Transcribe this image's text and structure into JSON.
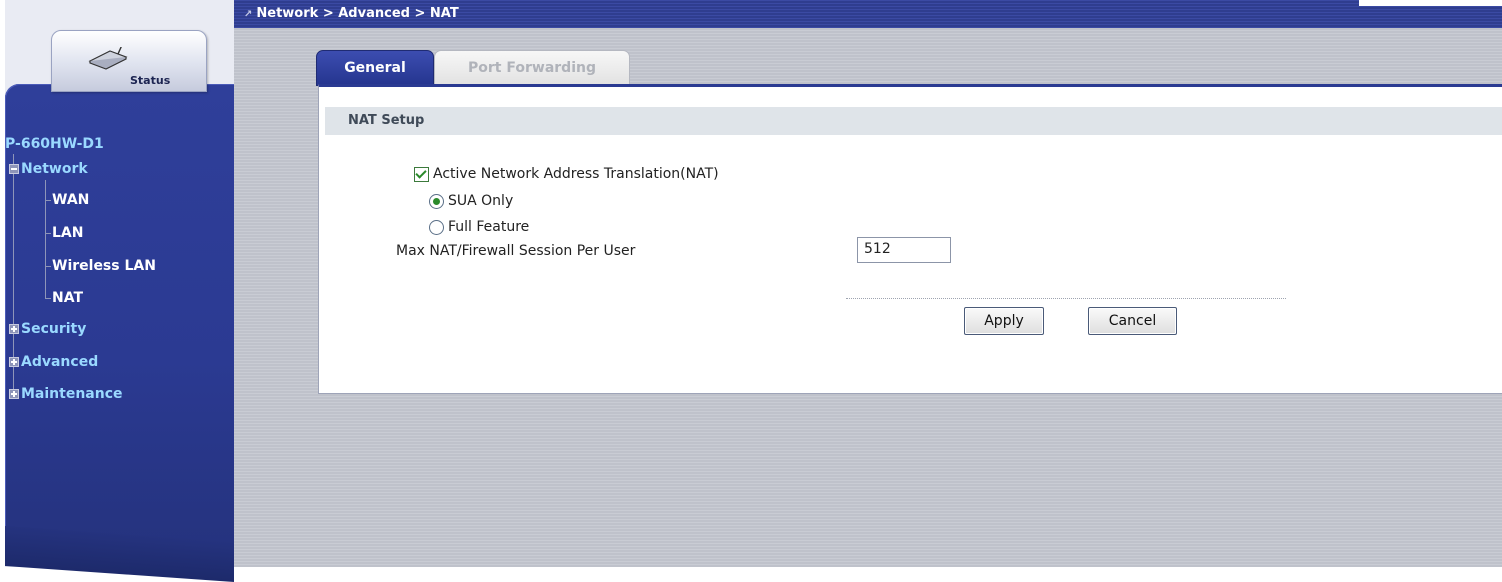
{
  "breadcrumb": {
    "text": "Network > Advanced > NAT"
  },
  "sidebar": {
    "status_label": "Status",
    "model": "P-660HW-D1",
    "nodes": [
      {
        "label": "Network",
        "expanded": true,
        "children": [
          "WAN",
          "LAN",
          "Wireless LAN",
          "NAT"
        ]
      },
      {
        "label": "Security",
        "expanded": false
      },
      {
        "label": "Advanced",
        "expanded": false
      },
      {
        "label": "Maintenance",
        "expanded": false
      }
    ]
  },
  "tabs": [
    {
      "label": "General",
      "active": true
    },
    {
      "label": "Port Forwarding",
      "active": false
    }
  ],
  "nat_setup": {
    "heading": "NAT Setup",
    "active_nat_label": "Active Network Address Translation(NAT)",
    "active_nat_checked": true,
    "mode_options": [
      "SUA Only",
      "Full Feature"
    ],
    "mode_selected": "SUA Only",
    "max_session_label": "Max NAT/Firewall Session Per User",
    "max_session_value": "512"
  },
  "buttons": {
    "apply": "Apply",
    "cancel": "Cancel"
  },
  "colors": {
    "sidebar_blue": "#2f3f9a",
    "accent_cyan": "#9ad9ff",
    "tab_active": "#25358f"
  },
  "icons": {
    "status": "router-icon"
  }
}
